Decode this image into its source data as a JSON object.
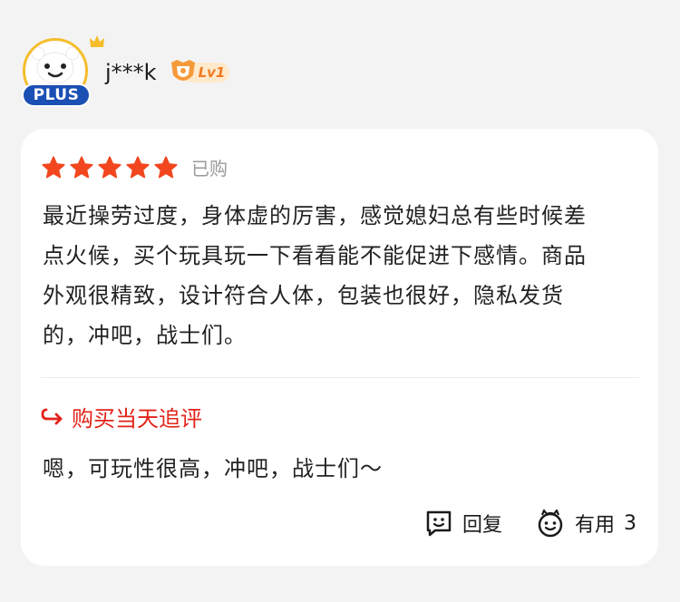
{
  "user": {
    "name": "j***k",
    "membership_badge": "PLUS",
    "level_label": "Lv1"
  },
  "review": {
    "star_count": 5,
    "rating_max": 5,
    "purchased_label": "已购",
    "text_lines": [
      "最近操劳过度，身体虚的厉害，感觉媳妇总有些时候差",
      "点火候，买个玩具玩一下看看能不能促进下感情。商品",
      "外观很精致，设计符合人体，包装也很好，隐私发货",
      "的，冲吧，战士们。"
    ],
    "followup_title": "购买当天追评",
    "followup_text": "嗯，可玩性很高，冲吧，战士们～"
  },
  "actions": {
    "reply_label": "回复",
    "useful_label": "有用",
    "useful_count": "3"
  },
  "colors": {
    "star": "#f2461e",
    "accent_red": "#e2231a",
    "plus_blue": "#1a4fb4",
    "avatar_ring": "#f5bd2c",
    "level_orange": "#f07a22"
  },
  "icons": {
    "reply": "comment-smile-icon",
    "useful": "thumbs-smile-icon",
    "followup": "return-arrow-icon"
  }
}
